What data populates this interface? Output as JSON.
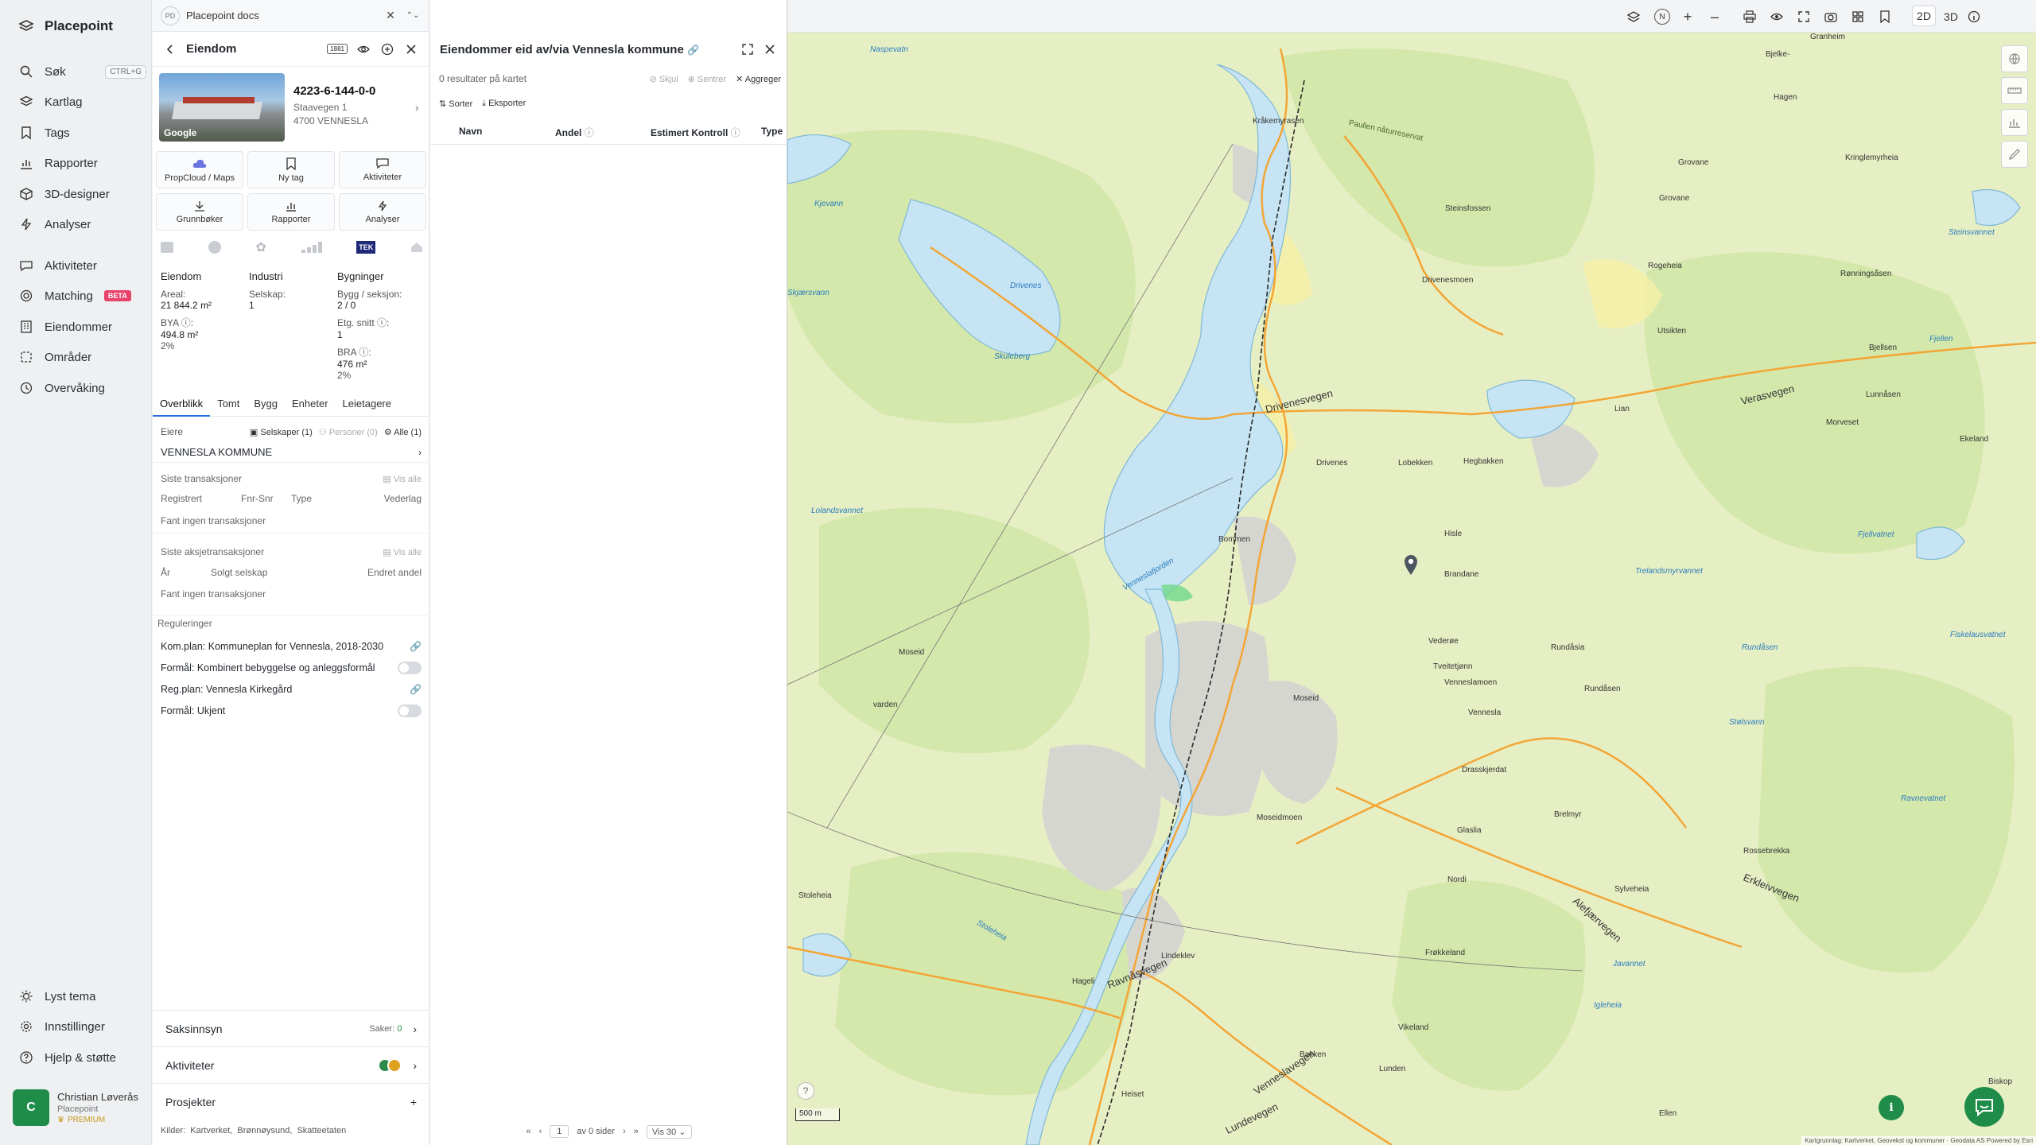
{
  "nav": {
    "brand": "Placepoint",
    "items": [
      {
        "label": "Søk",
        "shortcut": "CTRL+G",
        "icon": "search-icon"
      },
      {
        "label": "Kartlag",
        "icon": "layers-icon"
      },
      {
        "label": "Tags",
        "icon": "bookmark-icon"
      },
      {
        "label": "Rapporter",
        "icon": "chart-icon"
      },
      {
        "label": "3D-designer",
        "icon": "cube-icon"
      },
      {
        "label": "Analyser",
        "icon": "bolt-icon"
      },
      {
        "label": "Aktiviteter",
        "icon": "chat-icon"
      },
      {
        "label": "Matching",
        "badge": "BETA",
        "icon": "target-icon"
      },
      {
        "label": "Eiendommer",
        "icon": "building-icon"
      },
      {
        "label": "Områder",
        "icon": "area-icon"
      },
      {
        "label": "Overvåking",
        "icon": "monitor-icon"
      }
    ],
    "bottom": [
      {
        "label": "Lyst tema",
        "icon": "sun-icon"
      },
      {
        "label": "Innstillinger",
        "icon": "gear-icon"
      },
      {
        "label": "Hjelp & støtte",
        "icon": "help-icon"
      }
    ],
    "user": {
      "initial": "C",
      "name": "Christian Løverås",
      "org": "Placepoint",
      "tier": "PREMIUM"
    }
  },
  "panel1": {
    "doc_badge": "PD",
    "doc_title": "Placepoint docs",
    "header_title": "Eiendom",
    "header_badge": "1881",
    "property": {
      "id": "4223-6-144-0-0",
      "address": "Staavegen 1",
      "postal": "4700 VENNESLA",
      "thumb_label": "Google"
    },
    "actions": [
      {
        "label": "PropCloud / Maps",
        "icon": "cloud-icon"
      },
      {
        "label": "Ny tag",
        "icon": "bookmark-icon"
      },
      {
        "label": "Aktiviteter",
        "icon": "chat-icon"
      },
      {
        "label": "Grunnbøker",
        "icon": "download-icon"
      },
      {
        "label": "Rapporter",
        "icon": "chart-icon"
      },
      {
        "label": "Analyser",
        "icon": "bolt-icon"
      }
    ],
    "tek_label": "TEK",
    "facts": {
      "col1_title": "Eiendom",
      "areal_label": "Areal:",
      "areal_value": "21 844.2",
      "areal_unit": "m²",
      "bya_label": "BYA ⓘ:",
      "bya_value": "494.8",
      "bya_unit": "m²",
      "bya_pct": "2%",
      "col2_title": "Industri",
      "selskap_label": "Selskap:",
      "selskap_value": "1",
      "col3_title": "Bygninger",
      "bygg_label": "Bygg / seksjon:",
      "bygg_value": "2 / 0",
      "etg_label": "Etg. snitt ⓘ:",
      "etg_value": "1",
      "bra_label": "BRA ⓘ:",
      "bra_value": "476",
      "bra_unit": "m²",
      "bra_pct": "2%"
    },
    "tabs": [
      "Overblikk",
      "Tomt",
      "Bygg",
      "Enheter",
      "Leietagere"
    ],
    "owners": {
      "label": "Eiere",
      "filter_companies": "Selskaper (1)",
      "filter_persons": "Personer (0)",
      "filter_all": "Alle (1)",
      "owner_name": "VENNESLA KOMMUNE"
    },
    "transactions": {
      "title": "Siste transaksjoner",
      "view_all": "Vis alle",
      "cols": [
        "Registrert",
        "Fnr-Snr",
        "Type",
        "Vederlag"
      ],
      "empty": "Fant ingen transaksjoner"
    },
    "share_transactions": {
      "title": "Siste aksjetransaksjoner",
      "view_all": "Vis alle",
      "cols": [
        "År",
        "Solgt selskap",
        "Endret andel"
      ],
      "empty": "Fant ingen transaksjoner"
    },
    "regulations": {
      "title": "Reguleringer",
      "items": [
        {
          "label": "Kom.plan: Kommuneplan for Vennesla, 2018-2030",
          "control": "link"
        },
        {
          "label": "Formål: Kombinert bebyggelse og anleggsformål",
          "control": "toggle"
        },
        {
          "label": "Reg.plan: Vennesla Kirkegård",
          "control": "link"
        },
        {
          "label": "Formål: Ukjent",
          "control": "toggle"
        }
      ]
    },
    "sections": {
      "saksinnsyn": "Saksinnsyn",
      "saker_label": "Saker:",
      "saker_value": "0",
      "aktiviteter": "Aktiviteter",
      "prosjekter": "Prosjekter"
    },
    "sources_label": "Kilder:",
    "sources": [
      "Kartverket,",
      "Brønnøysund,",
      "Skatteetaten"
    ]
  },
  "panel2": {
    "title": "Eiendommer eid av/via Vennesla kommune",
    "result_count": "0 resultater på kartet",
    "hide": "Skjul",
    "center": "Sentrer",
    "aggregate": "Aggreger",
    "sort": "Sorter",
    "export": "Eksporter",
    "columns": [
      "Navn",
      "Andel",
      "Estimert Kontroll",
      "Type"
    ],
    "pager": {
      "page": "1",
      "of_pages": "av 0 sider",
      "per_page": "Vis 30"
    }
  },
  "topbar": {
    "mode_2d": "2D",
    "mode_3d": "3D",
    "north": "N"
  },
  "map": {
    "scale": "500 m",
    "attribution": "Kartgrunnlag: Kartverket, Geovekst og kommuner · Geodata AS Powered by Esri",
    "labels": [
      {
        "text": "Naspevatn",
        "kind": "water"
      },
      {
        "text": "Granheim",
        "kind": "place"
      },
      {
        "text": "Bjelke-",
        "kind": "place"
      },
      {
        "text": "Hagen",
        "kind": "place"
      },
      {
        "text": "Kråkemyrasen",
        "kind": "place"
      },
      {
        "text": "Paullen nåturreservat",
        "kind": "nature"
      },
      {
        "text": "Kringlemyrheia",
        "kind": "place"
      },
      {
        "text": "Grovane",
        "kind": "place"
      },
      {
        "text": "Steinsfossen",
        "kind": "place"
      },
      {
        "text": "Kjevann",
        "kind": "water"
      },
      {
        "text": "Rogeheia",
        "kind": "place"
      },
      {
        "text": "Rønningsåsen",
        "kind": "place"
      },
      {
        "text": "Drivenesmoen",
        "kind": "place"
      },
      {
        "text": "Drivenes",
        "kind": "water"
      },
      {
        "text": "Utsikten",
        "kind": "place"
      },
      {
        "text": "Bjellsen",
        "kind": "place"
      },
      {
        "text": "Skuleberg",
        "kind": "water"
      },
      {
        "text": "Drivenesvegen",
        "kind": "road"
      },
      {
        "text": "Lunnåsen",
        "kind": "place"
      },
      {
        "text": "Verasvegen",
        "kind": "road"
      },
      {
        "text": "Lian",
        "kind": "place"
      },
      {
        "text": "Morveset",
        "kind": "place"
      },
      {
        "text": "Ekeland",
        "kind": "place"
      },
      {
        "text": "Drivenes",
        "kind": "place"
      },
      {
        "text": "Lobekken",
        "kind": "place"
      },
      {
        "text": "Hegbakken",
        "kind": "place"
      },
      {
        "text": "Bommen",
        "kind": "place"
      },
      {
        "text": "Hisle",
        "kind": "place"
      },
      {
        "text": "Venneslafjorden",
        "kind": "water"
      },
      {
        "text": "Brandane",
        "kind": "place"
      },
      {
        "text": "Moseid",
        "kind": "place"
      },
      {
        "text": "Vederøe",
        "kind": "place"
      },
      {
        "text": "Tveitetjønn",
        "kind": "place"
      },
      {
        "text": "Venneslamoen",
        "kind": "place"
      },
      {
        "text": "Rundåsia",
        "kind": "place"
      },
      {
        "text": "Rundåsen",
        "kind": "water"
      },
      {
        "text": "Fiskelausvatnet",
        "kind": "water"
      },
      {
        "text": "varden",
        "kind": "place"
      },
      {
        "text": "Moseid",
        "kind": "place"
      },
      {
        "text": "Vennesla",
        "kind": "place"
      },
      {
        "text": "Rundåsen",
        "kind": "place"
      },
      {
        "text": "Stølsvann",
        "kind": "water"
      },
      {
        "text": "Drasskjerdat",
        "kind": "place"
      },
      {
        "text": "Moseidmoen",
        "kind": "place"
      },
      {
        "text": "Brelmyr",
        "kind": "place"
      },
      {
        "text": "Ravnevatnet",
        "kind": "water"
      },
      {
        "text": "Glaslia",
        "kind": "place"
      },
      {
        "text": "Rossebrekka",
        "kind": "place"
      },
      {
        "text": "Erkleivvegen",
        "kind": "road"
      },
      {
        "text": "Nordi",
        "kind": "place"
      },
      {
        "text": "Alefjærvegen",
        "kind": "road"
      },
      {
        "text": "Sylveheia",
        "kind": "place"
      },
      {
        "text": "Stoleheia",
        "kind": "place"
      },
      {
        "text": "Lindeklev",
        "kind": "place"
      },
      {
        "text": "Ravnåsvegen",
        "kind": "road"
      },
      {
        "text": "Hageli",
        "kind": "place"
      },
      {
        "text": "Frøkkeland",
        "kind": "place"
      },
      {
        "text": "Javannet",
        "kind": "water"
      },
      {
        "text": "Igleheia",
        "kind": "water"
      },
      {
        "text": "Venneslavegen",
        "kind": "road"
      },
      {
        "text": "Vikeland",
        "kind": "place"
      },
      {
        "text": "Bakken",
        "kind": "place"
      },
      {
        "text": "Lunden",
        "kind": "place"
      },
      {
        "text": "Heiset",
        "kind": "place"
      },
      {
        "text": "Lundevegen",
        "kind": "road"
      },
      {
        "text": "Ellen",
        "kind": "place"
      },
      {
        "text": "Biskop",
        "kind": "place"
      },
      {
        "text": "Stoleheia",
        "kind": "water"
      },
      {
        "text": "Lolandsvannet",
        "kind": "water"
      },
      {
        "text": "Trelandsmyrvannet",
        "kind": "water"
      },
      {
        "text": "Skjærsvann",
        "kind": "water"
      },
      {
        "text": "Fjellen",
        "kind": "water"
      },
      {
        "text": "Grovane",
        "kind": "place"
      },
      {
        "text": "Fjellvatnet",
        "kind": "water"
      },
      {
        "text": "Steinsvannet",
        "kind": "water"
      }
    ]
  },
  "colors": {
    "accent": "#2a6fe0",
    "brand_green": "#1f8d49",
    "beta": "#e8436a",
    "map_land": "#e8f0c8",
    "map_water": "#c8e6f5",
    "map_forest": "#cfe6a6"
  }
}
